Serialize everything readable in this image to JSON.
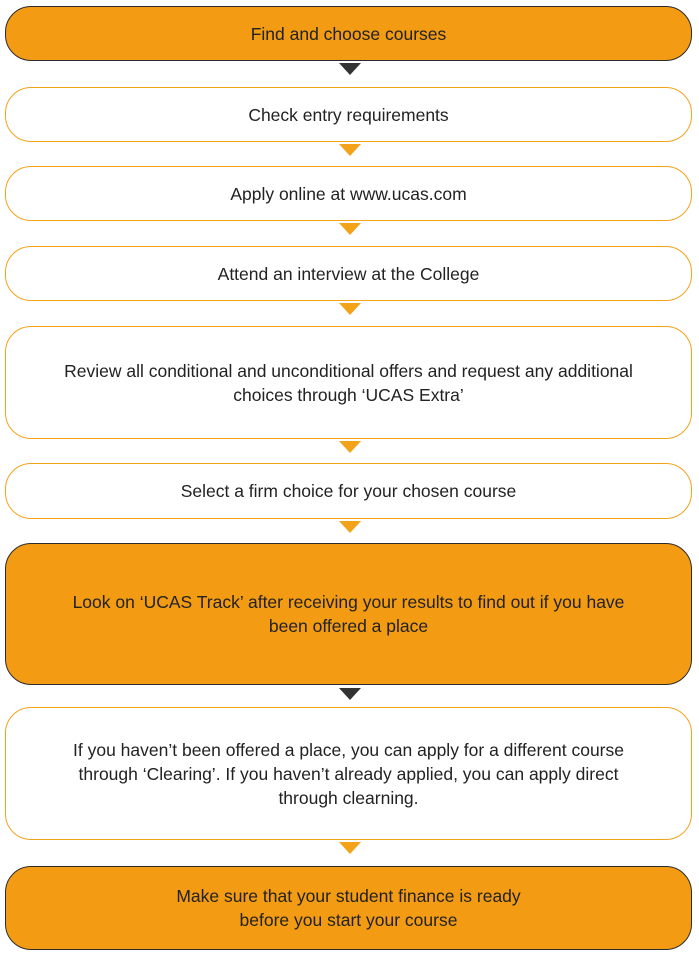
{
  "steps": [
    {
      "text": "Find and choose courses",
      "style": "filled"
    },
    {
      "text": "Check entry requirements",
      "style": "outline"
    },
    {
      "text": "Apply online at www.ucas.com",
      "style": "outline"
    },
    {
      "text": "Attend an interview at the College",
      "style": "outline"
    },
    {
      "text": "Review all conditional and unconditional offers and request any additional choices through ‘UCAS Extra’",
      "style": "outline"
    },
    {
      "text": "Select a firm choice for your chosen course",
      "style": "outline"
    },
    {
      "text": "Look on ‘UCAS Track’ after receiving your results to find out if you have been offered a place",
      "style": "filled"
    },
    {
      "text": "If you haven’t been offered a place, you can apply for a different course through ‘Clearing’. If you haven’t already applied, you can apply direct through clearning.",
      "style": "outline"
    },
    {
      "text": "Make sure that your student finance is ready before you start your course",
      "style": "filled"
    }
  ],
  "colors": {
    "orange": "#f29b13",
    "orange_outline": "#f3a31a",
    "dark_outline": "#2b2b2b",
    "dark_arrow": "#333333"
  },
  "arrows": [
    "dark-arrow-icon",
    "orange-arrow-icon",
    "orange-arrow-icon",
    "orange-arrow-icon",
    "orange-arrow-icon",
    "orange-arrow-icon",
    "dark-arrow-icon",
    "orange-arrow-icon"
  ]
}
